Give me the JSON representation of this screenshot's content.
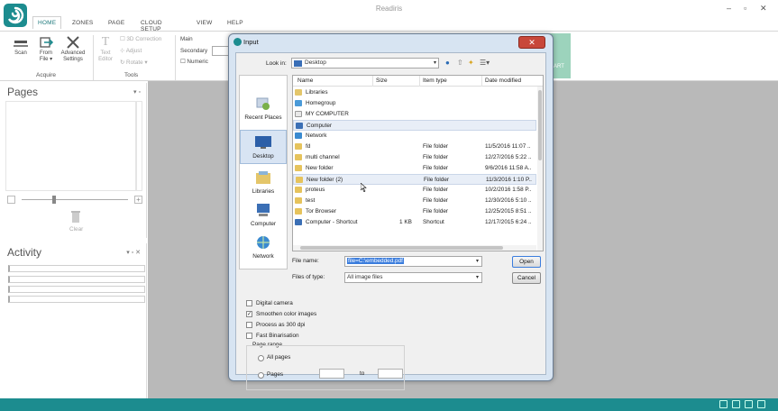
{
  "app": {
    "title": "Readiris",
    "window_controls": [
      "–",
      "▫",
      "✕"
    ]
  },
  "menu": {
    "tabs": [
      "HOME",
      "ZONES",
      "PAGE",
      "CLOUD SETUP",
      "VIEW",
      "HELP"
    ],
    "active": "HOME"
  },
  "ribbon": {
    "acquire": {
      "scan": "Scan",
      "from_file_1": "From",
      "from_file_2": "File ▾",
      "advanced_1": "Advanced",
      "advanced_2": "Settings",
      "group_label": "Acquire"
    },
    "tools": {
      "text_editor_1": "Text",
      "text_editor_2": "Editor",
      "items": [
        "3D Correction",
        "Adjust",
        "Rotate ▾"
      ],
      "group_label": "Tools"
    },
    "language": {
      "main_label": "Main",
      "secondary_label": "Secondary",
      "numeric_label": "Numeric"
    },
    "start_label": "ART"
  },
  "pages_panel": {
    "title": "Pages",
    "pin": "▾ ▫",
    "clear_label": "Clear"
  },
  "activity_panel": {
    "title": "Activity",
    "pin": "▾ ▫ ✕"
  },
  "dialog": {
    "title": "Input",
    "close": "✕",
    "look_in_label": "Look in:",
    "look_in_value": "Desktop",
    "places": [
      "Recent Places",
      "Desktop",
      "Libraries",
      "Computer",
      "Network"
    ],
    "columns": [
      "Name",
      "Size",
      "Item type",
      "Date modified"
    ],
    "files": [
      {
        "name": "Libraries",
        "size": "",
        "type": "",
        "date": "",
        "icon": "libraries-icon"
      },
      {
        "name": "Homegroup",
        "size": "",
        "type": "",
        "date": "",
        "icon": "homegroup-icon"
      },
      {
        "name": "MY COMPUTER",
        "size": "",
        "type": "",
        "date": "",
        "icon": "document-icon"
      },
      {
        "name": "Computer",
        "size": "",
        "type": "",
        "date": "",
        "icon": "computer-icon"
      },
      {
        "name": "Network",
        "size": "",
        "type": "",
        "date": "",
        "icon": "network-icon"
      },
      {
        "name": "fd",
        "size": "",
        "type": "File folder",
        "date": "11/5/2016 11:07 ..",
        "icon": "folder-icon"
      },
      {
        "name": "multi channel",
        "size": "",
        "type": "File folder",
        "date": "12/27/2016 5:22 ..",
        "icon": "folder-icon"
      },
      {
        "name": "New folder",
        "size": "",
        "type": "File folder",
        "date": "9/6/2016 11:58 A..",
        "icon": "folder-icon"
      },
      {
        "name": "New folder (2)",
        "size": "",
        "type": "File folder",
        "date": "11/3/2016 1:10 P..",
        "icon": "folder-icon"
      },
      {
        "name": "proteus",
        "size": "",
        "type": "File folder",
        "date": "10/2/2016 1:58 P..",
        "icon": "folder-icon"
      },
      {
        "name": "test",
        "size": "",
        "type": "File folder",
        "date": "12/30/2016 5:10 ..",
        "icon": "folder-icon"
      },
      {
        "name": "Tor Browser",
        "size": "",
        "type": "File folder",
        "date": "12/25/2015 8:51 ..",
        "icon": "folder-icon"
      },
      {
        "name": "Computer - Shortcut",
        "size": "1 KB",
        "type": "Shortcut",
        "date": "12/17/2015 6:24 ..",
        "icon": "shortcut-icon"
      }
    ],
    "file_name_label": "File name:",
    "file_name_value": "file=C:\\embedded.pdf",
    "files_of_type_label": "Files of type:",
    "files_of_type_value": "All image files",
    "open_button": "Open",
    "cancel_button": "Cancel",
    "options": [
      {
        "label": "Digital camera",
        "checked": false
      },
      {
        "label": "Smoothen color images",
        "checked": true
      },
      {
        "label": "Process as 300 dpi",
        "checked": false
      },
      {
        "label": "Fast Binarisation",
        "checked": false
      }
    ],
    "page_range": {
      "title": "Page range",
      "all_pages": "All pages",
      "pages": "Pages",
      "to": "to"
    }
  },
  "colors": {
    "brand_teal": "#1c8c8f",
    "workspace_gray": "#b9b9b9",
    "dialog_frame": "#d7e4f2",
    "close_red": "#c8473a"
  }
}
